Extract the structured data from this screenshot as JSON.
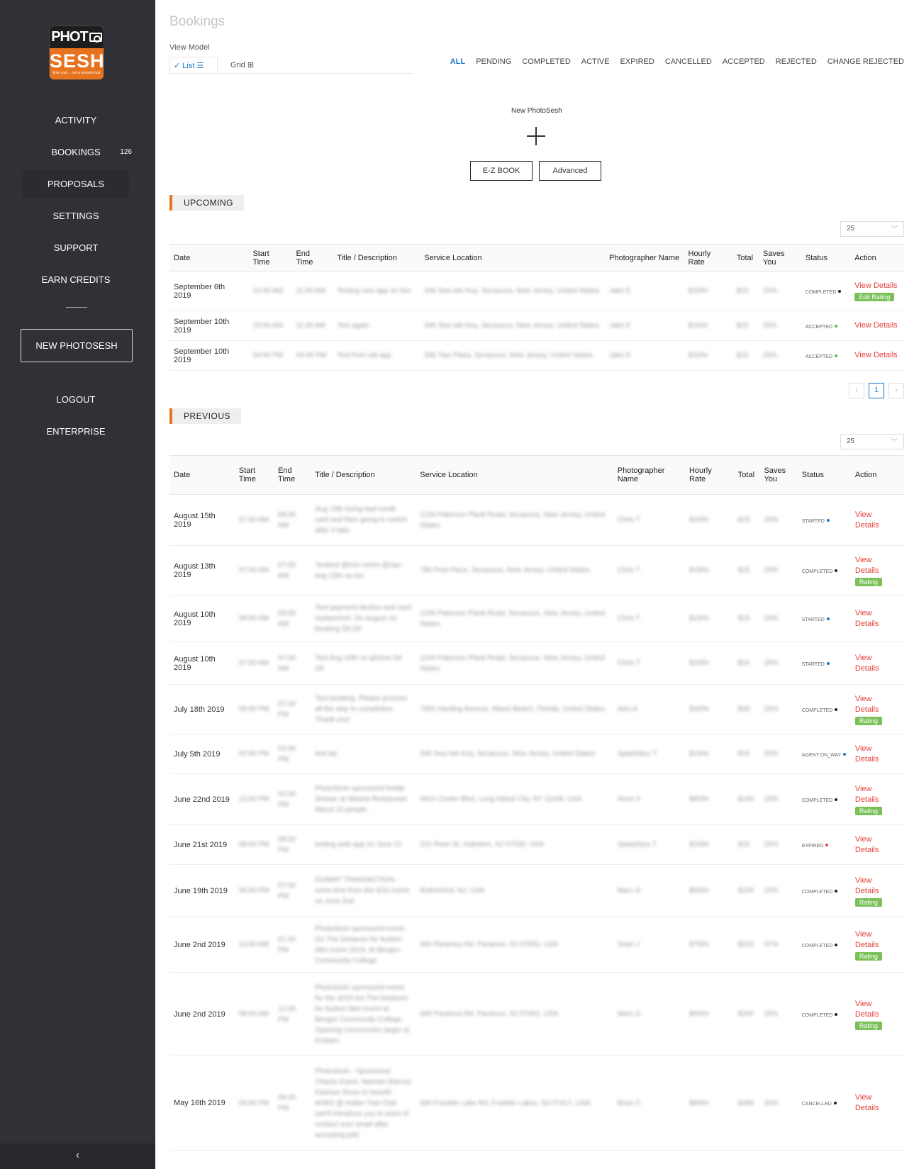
{
  "sidebar": {
    "logo_top": "PHOT",
    "logo_bottom": "SESH",
    "logo_tagline": "time cost ... not a moment lost",
    "items": [
      {
        "label": "ACTIVITY"
      },
      {
        "label": "BOOKINGS",
        "badge": "126"
      },
      {
        "label": "PROPOSALS"
      },
      {
        "label": "SETTINGS"
      },
      {
        "label": "SUPPORT"
      },
      {
        "label": "EARN CREDITS"
      }
    ],
    "new_photosesh": "NEW PHOTOSESH",
    "logout": "LOGOUT",
    "enterprise": "ENTERPRISE",
    "collapse": "‹"
  },
  "page": {
    "title": "Bookings",
    "view_model": "View Model",
    "list": "List ☰",
    "grid": "Grid ⊞",
    "list_check": "✓"
  },
  "filters": [
    "ALL",
    "PENDING",
    "COMPLETED",
    "ACTIVE",
    "EXPIRED",
    "CANCELLED",
    "ACCEPTED",
    "REJECTED",
    "CHANGE REJECTED"
  ],
  "new_sesh": {
    "label": "New PhotoSesh",
    "ez_book": "E-Z BOOK",
    "advanced": "Advanced"
  },
  "upcoming": {
    "title": "UPCOMING",
    "page_size": "25",
    "columns": [
      "Date",
      "Start Time",
      "End Time",
      "Title / Description",
      "Service Location",
      "Photographer Name",
      "Hourly Rate",
      "Total",
      "Saves You",
      "Status",
      "Action"
    ],
    "rows": [
      {
        "date": "September 6th 2019",
        "start": "10:00 AM",
        "end": "11:00 AM",
        "title": "Testing new app on live",
        "location": "346 Sea Isle Key, Secaucus, New Jersey, United States",
        "photographer": "Jake E",
        "rate": "$15/hr",
        "total": "$15",
        "saves": "25%",
        "status": "COMPLETED",
        "status_color": "#222222",
        "action": "View Details",
        "rating": "Edit Rating"
      },
      {
        "date": "September 10th 2019",
        "start": "10:00 AM",
        "end": "11:00 AM",
        "title": "Test again",
        "location": "346 Sea Isle Key, Secaucus, New Jersey, United States",
        "photographer": "Jake E",
        "rate": "$15/hr",
        "total": "$15",
        "saves": "25%",
        "status": "ACCEPTED",
        "status_color": "#5cb85c",
        "action": "View Details",
        "rating": ""
      },
      {
        "date": "September 10th 2019",
        "start": "04:00 PM",
        "end": "04:00 PM",
        "title": "Test from old app",
        "location": "330 Two Plaza, Secaucus, New Jersey, United States",
        "photographer": "Jake E",
        "rate": "$15/hr",
        "total": "$15",
        "saves": "25%",
        "status": "ACCEPTED",
        "status_color": "#5cb85c",
        "action": "View Details",
        "rating": ""
      }
    ],
    "pager_prev": "‹",
    "pager_page": "1",
    "pager_next": "›"
  },
  "previous": {
    "title": "PREVIOUS",
    "page_size": "25",
    "columns": [
      "Date",
      "Start Time",
      "End Time",
      "Title / Description",
      "Service Location",
      "Photographer Name",
      "Hourly Rate",
      "Total",
      "Saves You",
      "Status",
      "Action"
    ],
    "rows": [
      {
        "date": "August 15th 2019",
        "start": "07:00 AM",
        "end": "08:00 AM",
        "title": "Aug 15th trying bad credit card and then going to switch after it fails",
        "location": "1234 Paterson Plank Road, Secaucus, New Jersey, United States",
        "photographer": "Chris T",
        "rate": "$15/hr",
        "total": "$15",
        "saves": "25%",
        "status": "STARTED",
        "status_color": "#1677c9",
        "view": "View",
        "details": "Details",
        "rating": ""
      },
      {
        "date": "August 13th 2019",
        "start": "07:00 AM",
        "end": "07:00 AM",
        "title": "Testtest @min retrim @nan aug 13th cp too",
        "location": "780 Post Place, Secaucus, New Jersey, United States",
        "photographer": "Chris T",
        "rate": "$15/hr",
        "total": "$15",
        "saves": "25%",
        "status": "COMPLETED",
        "status_color": "#222222",
        "view": "View",
        "details": "Details",
        "rating": "Rating"
      },
      {
        "date": "August 10th 2019",
        "start": "08:00 AM",
        "end": "09:00 AM",
        "title": "Test payment decline and card replacemnt. On august 10 booking Dit Dit",
        "location": "1234 Paterson Plank Road, Secaucus, New Jersey, United States",
        "photographer": "Chris T",
        "rate": "$15/hr",
        "total": "$15",
        "saves": "25%",
        "status": "STARTED",
        "status_color": "#1677c9",
        "view": "View",
        "details": "Details",
        "rating": ""
      },
      {
        "date": "August 10th 2019",
        "start": "07:00 AM",
        "end": "07:00 AM",
        "title": "Test Aug 10th on iphone Dit Dit",
        "location": "1234 Paterson Plank Road, Secaucus, New Jersey, United States",
        "photographer": "Chris T",
        "rate": "$15/hr",
        "total": "$15",
        "saves": "25%",
        "status": "STARTED",
        "status_color": "#1677c9",
        "view": "View",
        "details": "Details",
        "rating": ""
      },
      {
        "date": "July 18th 2019",
        "start": "06:00 PM",
        "end": "07:00 PM",
        "title": "Test booking. Please process all the way to completion. Thank you!",
        "location": "7800 Harding Avenue, Miami Beach, Florida, United States",
        "photographer": "Alex A",
        "rate": "$30/hr",
        "total": "$30",
        "saves": "25%",
        "status": "COMPLETED",
        "status_color": "#222222",
        "view": "View",
        "details": "Details",
        "rating": "Rating"
      },
      {
        "date": "July 5th 2019",
        "start": "02:00 PM",
        "end": "02:00 PM",
        "title": "test las",
        "location": "346 Sea Isle Key, Secaucus, New Jersey, United States",
        "photographer": "Splashbox T",
        "rate": "$15/hr",
        "total": "$15",
        "saves": "25%",
        "status": "AGENT ON_WAY",
        "status_color": "#1677c9",
        "view": "View",
        "details": "Details",
        "rating": ""
      },
      {
        "date": "June 22nd 2019",
        "start": "12:00 PM",
        "end": "02:00 PM",
        "title": "PhotoSesh sponsored bridal shower at Wearia Restaurant. About 10 people.",
        "location": "4610 Center Blvd, Long Island City, NY 11109, USA",
        "photographer": "Anne V",
        "rate": "$80/hr",
        "total": "$160",
        "saves": "25%",
        "status": "COMPLETED",
        "status_color": "#222222",
        "view": "View",
        "details": "Details",
        "rating": "Rating"
      },
      {
        "date": "June 21st 2019",
        "start": "08:00 PM",
        "end": "08:00 PM",
        "title": "testing web app on June 21",
        "location": "221 River St, Hoboken, NJ 07030, USA",
        "photographer": "Splashbox T",
        "rate": "$15/hr",
        "total": "$15",
        "saves": "25%",
        "status": "EXPIRED",
        "status_color": "#e5403b",
        "view": "View",
        "details": "Details",
        "rating": ""
      },
      {
        "date": "June 19th 2019",
        "start": "06:00 PM",
        "end": "07:00 PM",
        "title": "DUMMY TRANSACTION - extra time from the 6/10 event on June 2nd.",
        "location": "Rutherford, NJ, USA",
        "photographer": "Marc G",
        "rate": "$50/hr",
        "total": "$100",
        "saves": "25%",
        "status": "COMPLETED",
        "status_color": "#222222",
        "view": "View",
        "details": "Details",
        "rating": "Rating"
      },
      {
        "date": "June 2nd 2019",
        "start": "10:00 AM",
        "end": "01:00 PM",
        "title": "PhotoSesh sponsored event - Go The Distance for Autism bike event 2019. At Bergen Community College",
        "location": "400 Paramus Rd, Paramus, NJ 07652, USA",
        "photographer": "Sean J",
        "rate": "$75/hr",
        "total": "$225",
        "saves": "37%",
        "status": "COMPLETED",
        "status_color": "#222222",
        "view": "View",
        "details": "Details",
        "rating": "Rating"
      },
      {
        "date": "June 2nd 2019",
        "start": "08:00 AM",
        "end": "12:00 PM",
        "title": "PhotoSesh sponsored event for the 2019 Go The Distance for Autism bike event at Bergen Community College. Opening Ceremonies begin at 8:00am.",
        "location": "400 Paramus Rd, Paramus, NJ 07652, USA",
        "photographer": "Marc G",
        "rate": "$50/hr",
        "total": "$200",
        "saves": "25%",
        "status": "COMPLETED",
        "status_color": "#222222",
        "view": "View",
        "details": "Details",
        "rating": "Rating"
      },
      {
        "date": "May 16th 2019",
        "start": "05:00 PM",
        "end": "08:00 PM",
        "title": "PhotoSesh - Sponsored Charity Event. Neiman Marcus Fashion Show to benefit AHBS @ Indian Trail Club (we'll introduce you to point of contact over email after accepting job)",
        "location": "830 Franklin Lake Rd, Franklin Lakes, NJ 07417, USA",
        "photographer": "Brian C",
        "rate": "$95/hr",
        "total": "$285",
        "saves": "30%",
        "status": "CANCELLED",
        "status_color": "#222222",
        "view": "View",
        "details": "Details",
        "rating": ""
      }
    ]
  }
}
